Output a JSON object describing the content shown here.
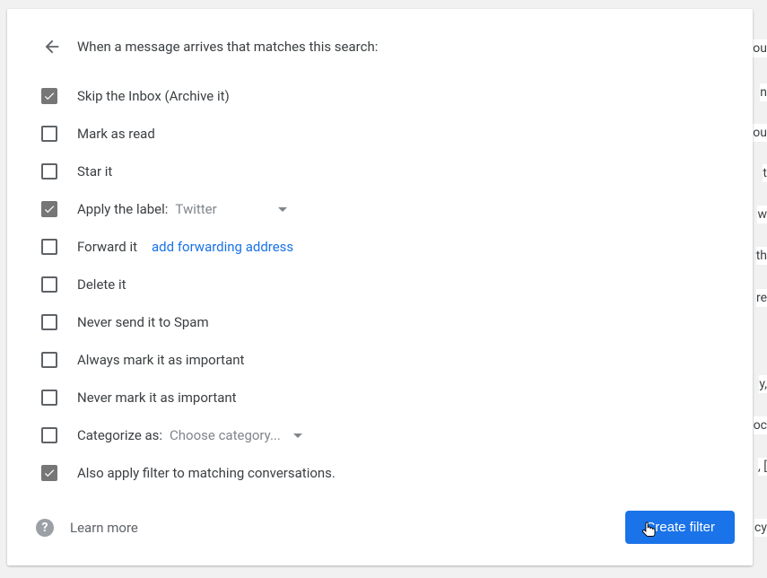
{
  "header": {
    "title": "When a message arrives that matches this search:"
  },
  "options": {
    "skip_inbox": {
      "label": "Skip the Inbox (Archive it)",
      "checked": true
    },
    "mark_read": {
      "label": "Mark as read",
      "checked": false
    },
    "star": {
      "label": "Star it",
      "checked": false
    },
    "apply_label": {
      "label": "Apply the label:",
      "checked": true,
      "value": "Twitter"
    },
    "forward": {
      "label": "Forward it",
      "checked": false,
      "link": "add forwarding address"
    },
    "delete": {
      "label": "Delete it",
      "checked": false
    },
    "never_spam": {
      "label": "Never send it to Spam",
      "checked": false
    },
    "always_important": {
      "label": "Always mark it as important",
      "checked": false
    },
    "never_important": {
      "label": "Never mark it as important",
      "checked": false
    },
    "categorize": {
      "label": "Categorize as:",
      "checked": false,
      "value": "Choose category..."
    },
    "apply_existing": {
      "label": "Also apply filter to matching conversations.",
      "checked": true
    }
  },
  "footer": {
    "learn_more": "Learn more",
    "create_button": "Create filter"
  },
  "background_snippets": [
    "ou",
    "n",
    "ou",
    "t",
    "w",
    "th",
    "re",
    "y,",
    "oc",
    ", [",
    "cy"
  ]
}
